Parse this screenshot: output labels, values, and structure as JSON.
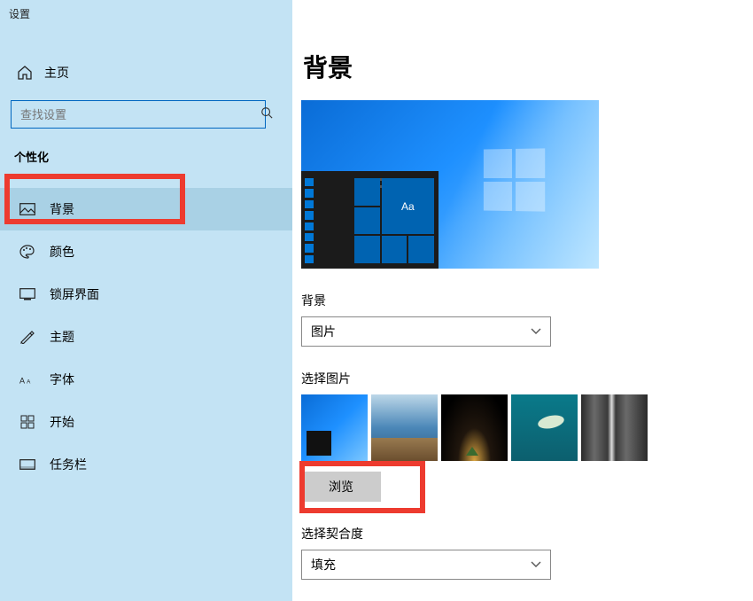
{
  "window_title": "设置",
  "home_label": "主页",
  "search_placeholder": "查找设置",
  "section_header": "个性化",
  "nav": [
    {
      "id": "background",
      "label": "背景",
      "selected": true
    },
    {
      "id": "colors",
      "label": "颜色",
      "selected": false
    },
    {
      "id": "lockscreen",
      "label": "锁屏界面",
      "selected": false
    },
    {
      "id": "themes",
      "label": "主题",
      "selected": false
    },
    {
      "id": "fonts",
      "label": "字体",
      "selected": false
    },
    {
      "id": "start",
      "label": "开始",
      "selected": false
    },
    {
      "id": "taskbar",
      "label": "任务栏",
      "selected": false
    }
  ],
  "page_title": "背景",
  "preview_tile_text": "Aa",
  "bg_section_label": "背景",
  "bg_select_value": "图片",
  "choose_picture_label": "选择图片",
  "browse_label": "浏览",
  "fit_label": "选择契合度",
  "fit_value": "填充"
}
